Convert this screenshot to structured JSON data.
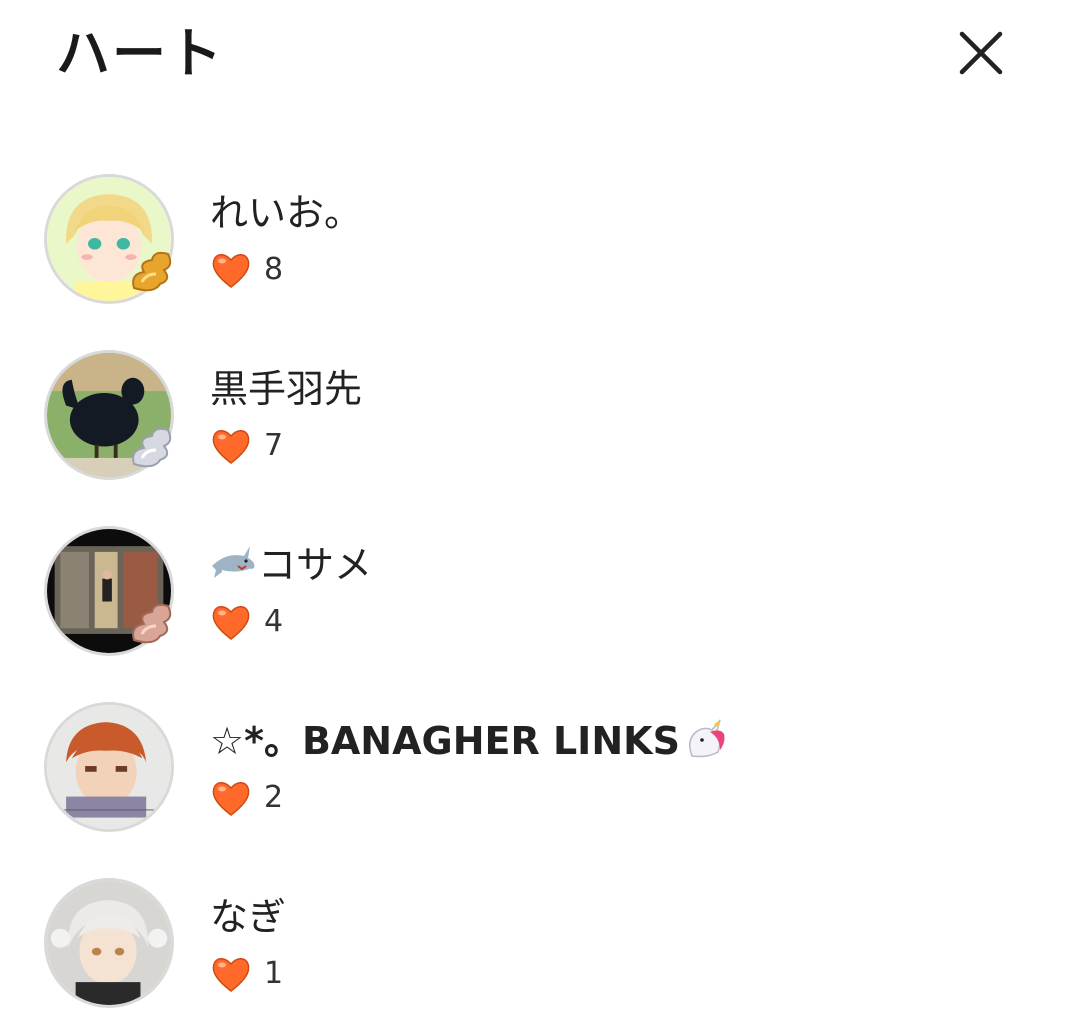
{
  "header": {
    "title": "ハート",
    "close_icon": "close-icon"
  },
  "colors": {
    "heart": "#ff6a2b",
    "text": "#222222",
    "avatar_border": "#d9d9d9"
  },
  "users": [
    {
      "name": "れいお。",
      "emoji": "",
      "count": "8",
      "badge": "gold"
    },
    {
      "name": "黒手羽先",
      "emoji": "",
      "count": "7",
      "badge": "silver"
    },
    {
      "name": "コサメ",
      "emoji": "shark",
      "count": "4",
      "badge": "bronze"
    },
    {
      "name": "☆*。BANAGHER LINKS",
      "emoji_after": "unicorn",
      "count": "2",
      "badge": ""
    },
    {
      "name": "なぎ",
      "emoji": "",
      "count": "1",
      "badge": ""
    }
  ]
}
